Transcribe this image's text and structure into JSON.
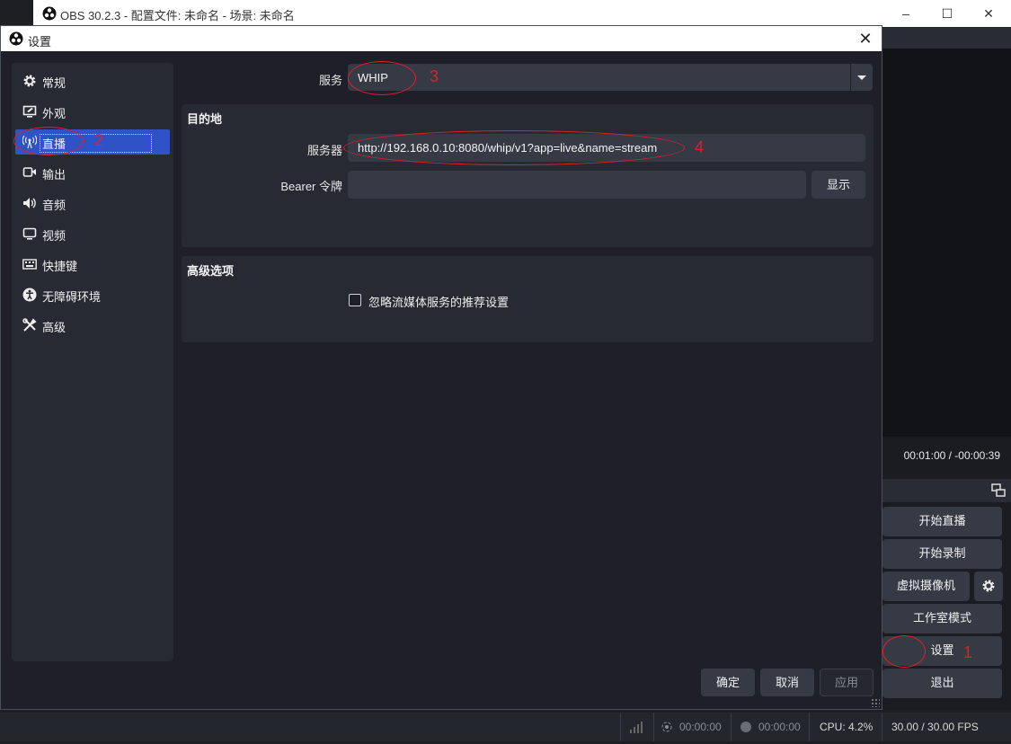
{
  "main_window": {
    "title": "OBS 30.2.3 - 配置文件: 未命名 - 场景: 未命名",
    "media_time": "00:01:00  /  -00:00:39",
    "controls": [
      {
        "label": "开始直播"
      },
      {
        "label": "开始录制"
      },
      {
        "label": "虚拟摄像机"
      },
      {
        "label": "工作室模式"
      },
      {
        "label": "设置"
      },
      {
        "label": "退出"
      }
    ],
    "status": {
      "stream_time": "00:00:00",
      "record_time": "00:00:00",
      "cpu": "CPU: 4.2%",
      "fps": "30.00 / 30.00 FPS"
    }
  },
  "dialog": {
    "title": "设置",
    "sidebar": [
      {
        "label": "常规",
        "icon": "gear-icon"
      },
      {
        "label": "外观",
        "icon": "appearance-icon"
      },
      {
        "label": "直播",
        "icon": "broadcast-icon"
      },
      {
        "label": "输出",
        "icon": "output-icon"
      },
      {
        "label": "音频",
        "icon": "speaker-icon"
      },
      {
        "label": "视频",
        "icon": "monitor-icon"
      },
      {
        "label": "快捷键",
        "icon": "keyboard-icon"
      },
      {
        "label": "无障碍环境",
        "icon": "accessibility-icon"
      },
      {
        "label": "高级",
        "icon": "tools-icon"
      }
    ],
    "active_item": "直播",
    "service": {
      "label": "服务",
      "value": "WHIP"
    },
    "destination": {
      "title": "目的地",
      "server_label": "服务器",
      "server_value": "http://192.168.0.10:8080/whip/v1?app=live&name=stream",
      "token_label": "Bearer 令牌",
      "token_value": "",
      "show_button": "显示"
    },
    "advanced": {
      "title": "高级选项",
      "ignore_checkbox_label": "忽略流媒体服务的推荐设置",
      "ignore_checked": false
    },
    "buttons": {
      "ok": "确定",
      "cancel": "取消",
      "apply": "应用"
    }
  },
  "annotations": [
    "1",
    "2",
    "3",
    "4"
  ],
  "colors": {
    "accent": "#2f52c7",
    "annotation": "#e0202a"
  }
}
